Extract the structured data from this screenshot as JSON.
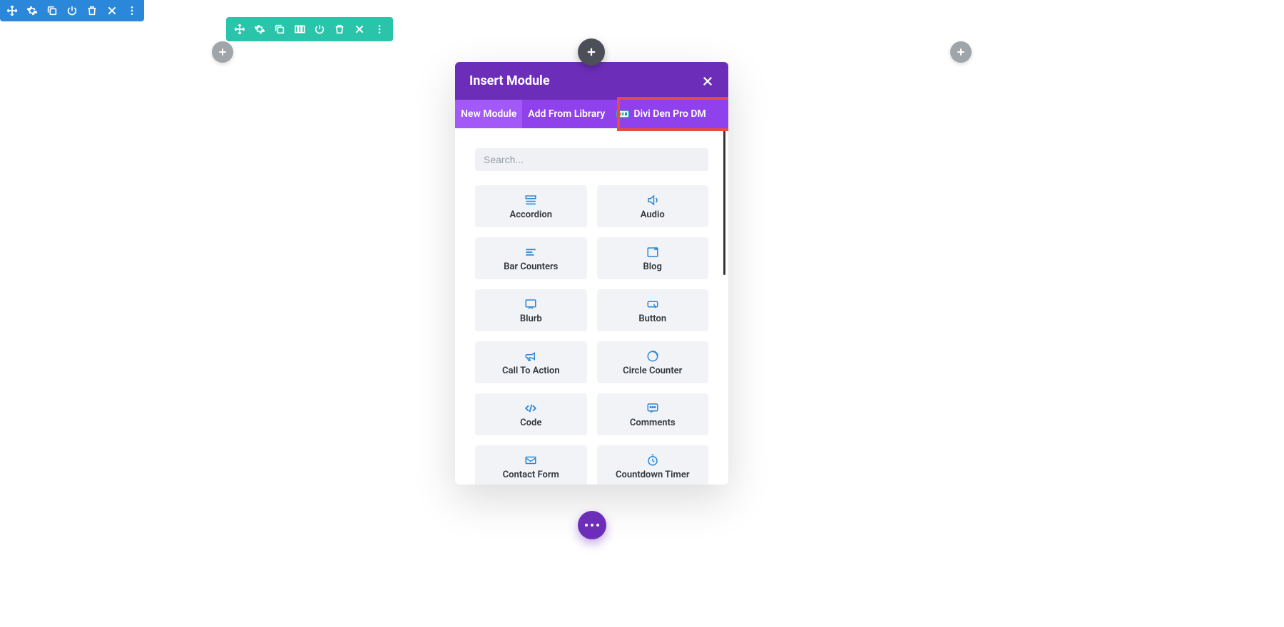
{
  "modal": {
    "title": "Insert Module",
    "tabs": [
      {
        "label": "New Module"
      },
      {
        "label": "Add From Library"
      },
      {
        "label": "Divi Den Pro DM"
      }
    ],
    "search_placeholder": "Search...",
    "modules": [
      {
        "label": "Accordion"
      },
      {
        "label": "Audio"
      },
      {
        "label": "Bar Counters"
      },
      {
        "label": "Blog"
      },
      {
        "label": "Blurb"
      },
      {
        "label": "Button"
      },
      {
        "label": "Call To Action"
      },
      {
        "label": "Circle Counter"
      },
      {
        "label": "Code"
      },
      {
        "label": "Comments"
      },
      {
        "label": "Contact Form"
      },
      {
        "label": "Countdown Timer"
      }
    ]
  }
}
